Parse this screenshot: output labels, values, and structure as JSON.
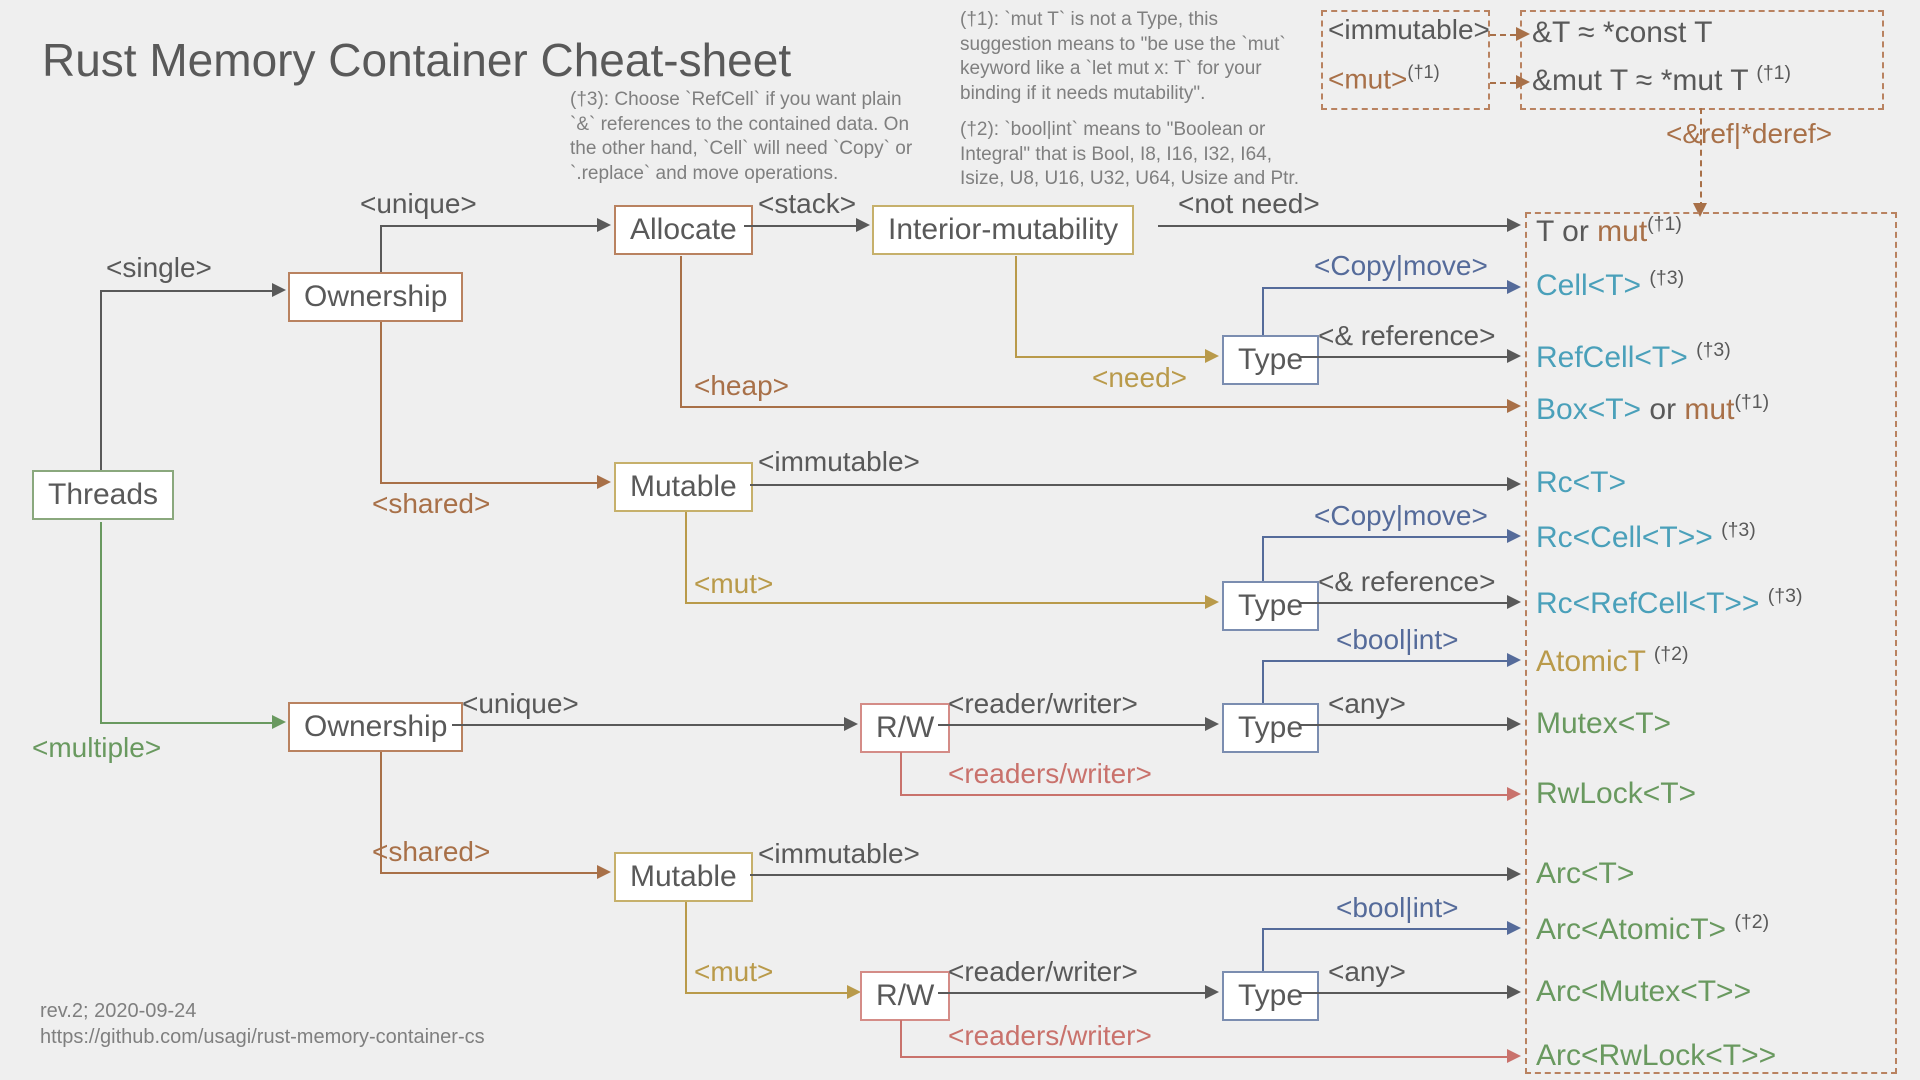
{
  "title": "Rust Memory Container Cheat-sheet",
  "meta": {
    "rev": "rev.2; 2020-09-24",
    "url": "https://github.com/usagi/rust-memory-container-cs"
  },
  "footnotes": {
    "f3": "(†3): Choose `RefCell` if you want plain `&` references to the contained data. On the other hand, `Cell` will need `Copy` or `.replace` and move operations.",
    "f1": "(†1): `mut T` is not a Type, this suggestion means to \"be use the `mut` keyword like a `let mut x: T` for your binding if it needs mutability\".",
    "f2": "(†2): `bool|int` means to \"Boolean or Integral\" that is Bool, I8, I16, I32, I64, Isize, U8, U16, U32, U64, Usize and Ptr."
  },
  "nodes": {
    "threads": "Threads",
    "ownership": "Ownership",
    "allocate": "Allocate",
    "intmut": "Interior-mutability",
    "mutable": "Mutable",
    "type": "Type",
    "rw": "R/W"
  },
  "tags": {
    "single": "<single>",
    "multiple": "<multiple>",
    "unique": "<unique>",
    "shared": "<shared>",
    "stack": "<stack>",
    "heap": "<heap>",
    "notneed": "<not need>",
    "need": "<need>",
    "immutable": "<immutable>",
    "mut": "<mut>",
    "copymove": "<Copy|move>",
    "ampref": "<& reference>",
    "rw1": "<reader/writer>",
    "rws": "<readers/writer>",
    "boolint": "<bool|int>",
    "any": "<any>",
    "refderef": "<&ref|*deref>"
  },
  "top": {
    "imm": "<immutable>",
    "mut": "<mut>",
    "sup": "(†1)",
    "ref_const": "&T ≈ *const T",
    "ref_mut_pre": "&mut T ≈ *mut T ",
    "ref_mut_sup": "(†1)"
  },
  "leaves": {
    "t_or_mut_a": "T",
    "t_or_mut_b": " or ",
    "t_or_mut_c": "mut",
    "t_sup": "(†1)",
    "cell": "Cell<T>",
    "cell_sup": "(†3)",
    "refcell": "RefCell<T>",
    "refcell_sup": "(†3)",
    "box_a": "Box<T>",
    "box_b": " or ",
    "box_c": "mut",
    "box_sup": "(†1)",
    "rc": "Rc<T>",
    "rccell": "Rc<Cell<T>>",
    "rccell_sup": "(†3)",
    "rcrefcell": "Rc<RefCell<T>>",
    "rcrefcell_sup": "(†3)",
    "atomic": "AtomicT",
    "atomic_sup": "(†2)",
    "mutex": "Mutex<T>",
    "rwlock": "RwLock<T>",
    "arc": "Arc<T>",
    "arcatomic": "Arc<AtomicT>",
    "arcatomic_sup": "(†2)",
    "arcmutex": "Arc<Mutex<T>>",
    "arcrwlock": "Arc<RwLock<T>>"
  }
}
